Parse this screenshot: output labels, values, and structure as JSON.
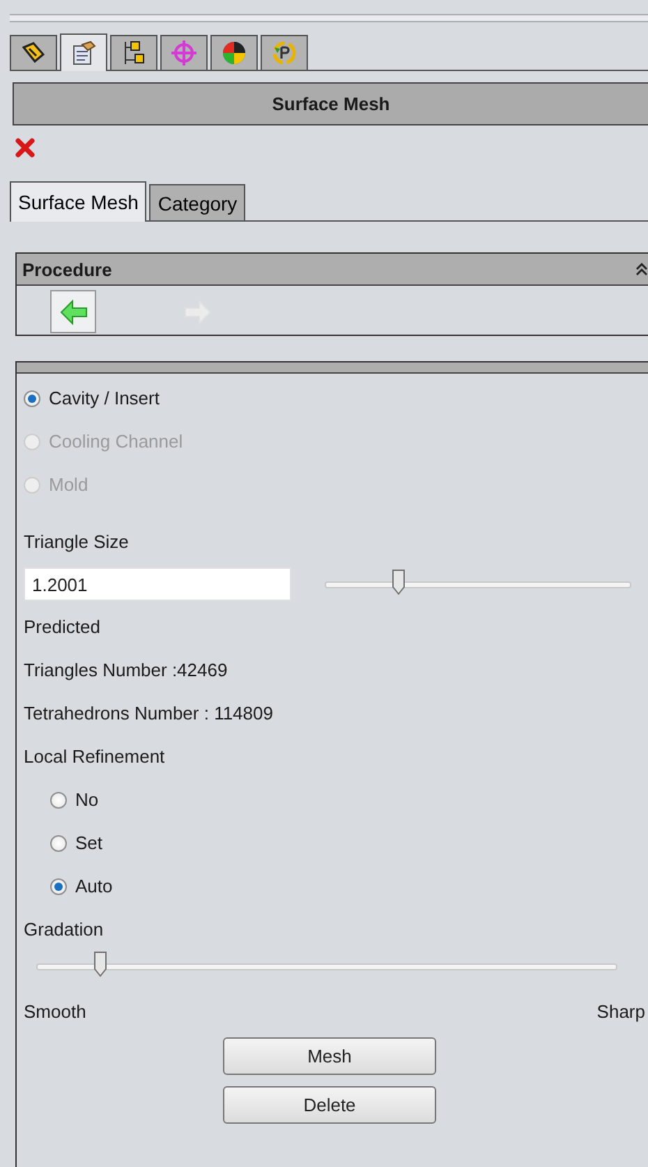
{
  "toolbar_tabs": [
    {
      "selected": false
    },
    {
      "selected": true
    },
    {
      "selected": false
    },
    {
      "selected": false
    },
    {
      "selected": false
    },
    {
      "selected": false
    }
  ],
  "title": "Surface Mesh",
  "tabs": [
    {
      "label": "Surface Mesh",
      "selected": true
    },
    {
      "label": "Category",
      "selected": false
    }
  ],
  "procedure": {
    "title": "Procedure",
    "back": {
      "disabled": false
    },
    "forward": {
      "disabled": true
    }
  },
  "targets": [
    {
      "label": "Cavity / Insert",
      "selected": true,
      "disabled": false
    },
    {
      "label": "Cooling Channel",
      "selected": false,
      "disabled": true
    },
    {
      "label": "Mold",
      "selected": false,
      "disabled": true
    }
  ],
  "triangle_size": {
    "label": "Triangle Size",
    "value": "1.2001",
    "level": 0.24
  },
  "predicted": "Predicted",
  "triangles": "Triangles Number :42469",
  "tetrahedrons": "Tetrahedrons Number : 114809",
  "local_refinement": {
    "label": "Local Refinement",
    "options": [
      {
        "label": "No",
        "selected": false,
        "disabled": false
      },
      {
        "label": "Set",
        "selected": false,
        "disabled": false
      },
      {
        "label": "Auto",
        "selected": true,
        "disabled": false
      }
    ]
  },
  "gradation": {
    "label": "Gradation",
    "level": 0.11,
    "min_label": "Smooth",
    "max_label": "Sharp"
  },
  "buttons": [
    "Mesh",
    "Delete"
  ]
}
